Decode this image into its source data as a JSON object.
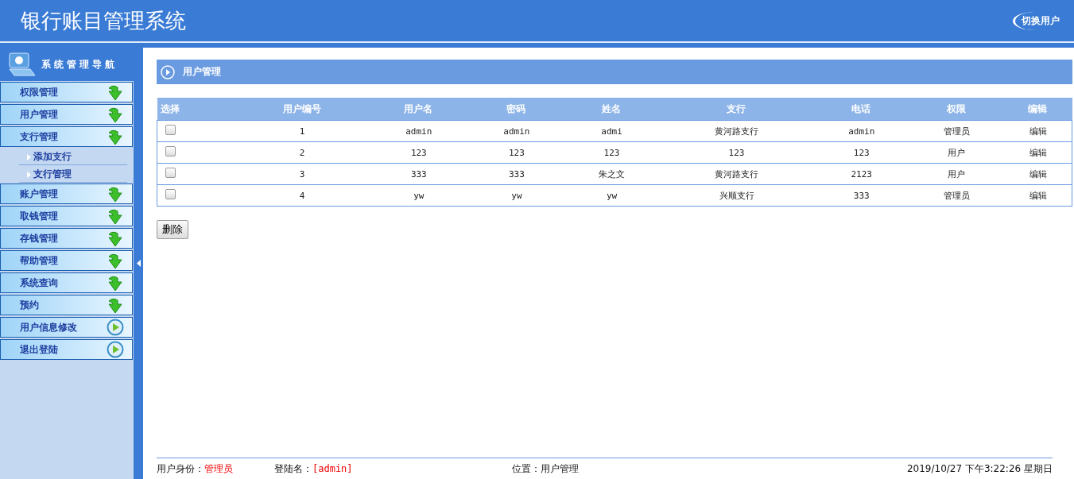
{
  "header": {
    "title": "银行账目管理系统",
    "switch_user": "切换用户"
  },
  "sidebar": {
    "title": "系统管理导航",
    "items": [
      {
        "label": "权限管理",
        "kind": "arrow"
      },
      {
        "label": "用户管理",
        "kind": "arrow"
      },
      {
        "label": "支行管理",
        "kind": "arrow",
        "children": [
          {
            "label": "添加支行"
          },
          {
            "label": "支行管理"
          }
        ]
      },
      {
        "label": "账户管理",
        "kind": "arrow"
      },
      {
        "label": "取钱管理",
        "kind": "arrow"
      },
      {
        "label": "存钱管理",
        "kind": "arrow"
      },
      {
        "label": "帮助管理",
        "kind": "arrow"
      },
      {
        "label": "系统查询",
        "kind": "arrow"
      },
      {
        "label": "预约",
        "kind": "arrow"
      },
      {
        "label": "用户信息修改",
        "kind": "play"
      },
      {
        "label": "退出登陆",
        "kind": "play"
      }
    ]
  },
  "panel_title": "用户管理",
  "table": {
    "columns": [
      "选择",
      "用户编号",
      "用户名",
      "密码",
      "姓名",
      "支行",
      "电话",
      "权限",
      "编辑"
    ],
    "rows": [
      {
        "checked": false,
        "cells": [
          "",
          "1",
          "admin",
          "admin",
          "admi",
          "黄河路支行",
          "admin",
          "管理员",
          "编辑"
        ]
      },
      {
        "checked": false,
        "cells": [
          "",
          "2",
          "123",
          "123",
          "123",
          "123",
          "123",
          "用户",
          "编辑"
        ]
      },
      {
        "checked": false,
        "cells": [
          "",
          "3",
          "333",
          "333",
          "朱之文",
          "黄河路支行",
          "2123",
          "用户",
          "编辑"
        ]
      },
      {
        "checked": false,
        "cells": [
          "",
          "4",
          "yw",
          "yw",
          "yw",
          "兴顺支行",
          "333",
          "管理员",
          "编辑"
        ]
      }
    ]
  },
  "delete_button": "删除",
  "status_bar": {
    "identity_label": "用户身份：",
    "identity": "管理员",
    "login_label": "登陆名：",
    "login": "[admin]",
    "location": "位置：用户管理",
    "datetime": "2019/10/27 下午3:22:26 星期日"
  }
}
